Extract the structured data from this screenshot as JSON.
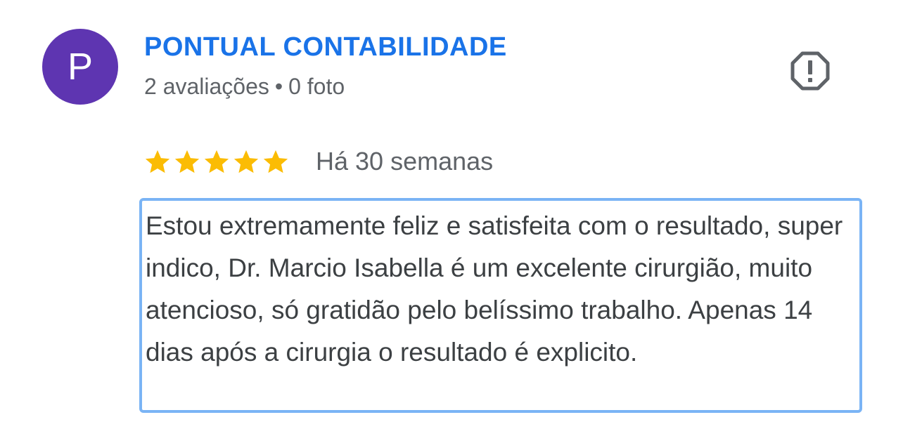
{
  "review": {
    "author": {
      "initial": "P",
      "name": "PONTUAL CONTABILIDADE",
      "reviews_count": "2 avaliações",
      "separator": "•",
      "photos_count": "0 foto",
      "avatar_color": "#5e35b1"
    },
    "report_icon": "report-flag-icon",
    "rating": 5,
    "rating_max": 5,
    "star_color": "#fbbc04",
    "timestamp": "Há 30 semanas",
    "text": "Estou extremamente feliz e satisfeita com o resultado, super indico, Dr. Marcio Isabella é um excelente cirurgião, muito atencioso, só gratidão pelo belíssimo trabalho. Apenas 14 dias após a cirurgia o resultado é explicito.",
    "text_color": "#3c4043",
    "name_color": "#1a73e8",
    "selection_border_color": "#7ab4f5"
  }
}
